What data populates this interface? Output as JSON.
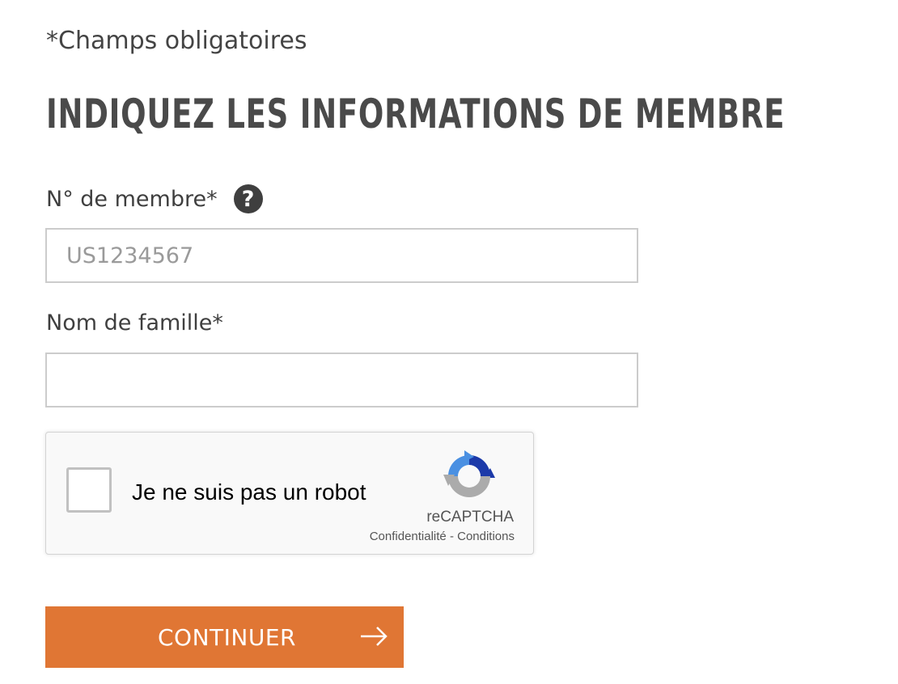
{
  "form": {
    "required_note": "*Champs obligatoires",
    "title": "INDIQUEZ LES INFORMATIONS DE MEMBRE",
    "member_number": {
      "label": "N° de membre*",
      "placeholder": "US1234567",
      "value": "",
      "help_icon": "question-mark-circle-icon"
    },
    "last_name": {
      "label": "Nom de famille*",
      "placeholder": "",
      "value": ""
    },
    "recaptcha": {
      "label": "Je ne suis pas un robot",
      "brand": "reCAPTCHA",
      "privacy": "Confidentialité",
      "separator": "-",
      "terms": "Conditions",
      "checked": false,
      "logo_icon": "recaptcha-logo-icon"
    },
    "continue_button": {
      "label": "CONTINUER",
      "icon": "arrow-right-icon"
    }
  },
  "colors": {
    "accent": "#e07634",
    "text": "#3f3f3f",
    "border": "#cccccc"
  }
}
